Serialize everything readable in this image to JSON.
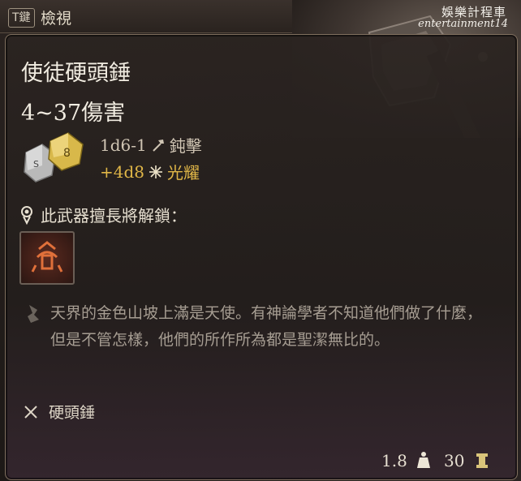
{
  "topbar": {
    "key_label": "T鍵",
    "action_label": "檢視"
  },
  "watermark": {
    "line1": "娛樂計程車",
    "line2": "entertainment14"
  },
  "item": {
    "name": "使徒硬頭錘",
    "damage_summary": "4~37傷害",
    "damage_lines": [
      {
        "dice": "1d6-1",
        "type_label": "鈍擊",
        "icon": "hammer-icon"
      },
      {
        "dice": "+4d8",
        "type_label": "光耀",
        "icon": "radiant-icon"
      }
    ],
    "unlock_label": "此武器擅長將解鎖：",
    "description": "天界的金色山坡上滿是天使。有神論學者不知道他們做了什麼，但是不管怎樣，他們的所作所為都是聖潔無比的。",
    "proficiency_label": "硬頭錘",
    "weight": "1.8",
    "price": "30"
  },
  "colors": {
    "radiant": "#e0b647",
    "text": "#f1ece1",
    "muted": "#a69d92"
  }
}
